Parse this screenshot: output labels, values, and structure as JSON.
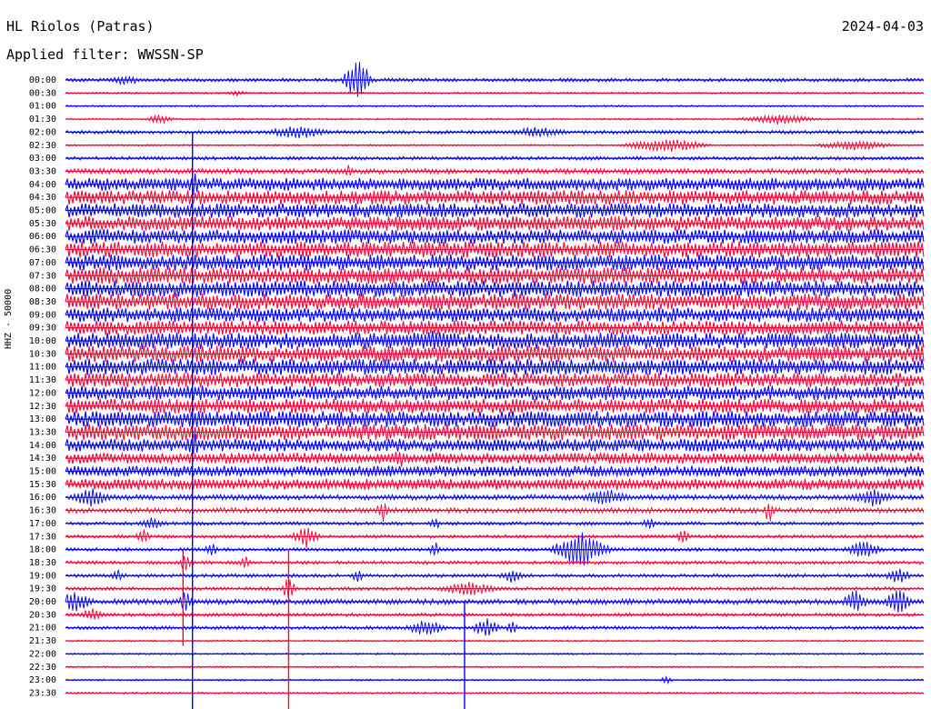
{
  "header": {
    "station": "HL Riolos (Patras)",
    "date": "2024-04-03",
    "filter_text": "Applied filter: WWSSN-SP"
  },
  "channel_label": "HHZ - 50000",
  "colors": {
    "trace_a": "#0000ff",
    "trace_b": "#ff0033",
    "text": "#000000"
  },
  "chart_data": {
    "type": "line",
    "title": "HL Riolos (Patras)",
    "subtitle": "Applied filter: WWSSN-SP",
    "ylabel": "HHZ - 50000",
    "xlabel": "",
    "grid": false,
    "row_labels": [
      "00:00",
      "00:30",
      "01:00",
      "01:30",
      "02:00",
      "02:30",
      "03:00",
      "03:30",
      "04:00",
      "04:30",
      "05:00",
      "05:30",
      "06:00",
      "06:30",
      "07:00",
      "07:30",
      "08:00",
      "08:30",
      "09:00",
      "09:30",
      "10:00",
      "10:30",
      "11:00",
      "11:30",
      "12:00",
      "12:30",
      "13:00",
      "13:30",
      "14:00",
      "14:30",
      "15:00",
      "15:30",
      "16:00",
      "16:30",
      "17:00",
      "17:30",
      "18:00",
      "18:30",
      "19:00",
      "19:30",
      "20:00",
      "20:30",
      "21:00",
      "21:30",
      "22:00",
      "22:30",
      "23:00",
      "23:30"
    ],
    "noise_level": [
      2,
      1,
      1,
      1,
      2,
      1,
      2,
      3,
      7,
      8,
      8,
      8,
      8,
      9,
      9,
      9,
      9,
      9,
      8,
      8,
      9,
      9,
      9,
      8,
      8,
      8,
      9,
      9,
      7,
      6,
      6,
      6,
      3,
      3,
      2,
      2,
      2,
      2,
      2,
      2,
      3,
      2,
      2,
      1,
      1,
      1,
      1,
      1
    ],
    "bursts": [
      {
        "row": 0,
        "x": 0.34,
        "amp": 28,
        "width": 0.02
      },
      {
        "row": 0,
        "x": 0.07,
        "amp": 6,
        "width": 0.03
      },
      {
        "row": 1,
        "x": 0.2,
        "amp": 3,
        "width": 0.02
      },
      {
        "row": 3,
        "x": 0.11,
        "amp": 6,
        "width": 0.02
      },
      {
        "row": 3,
        "x": 0.83,
        "amp": 6,
        "width": 0.06
      },
      {
        "row": 4,
        "x": 0.27,
        "amp": 8,
        "width": 0.05
      },
      {
        "row": 4,
        "x": 0.55,
        "amp": 6,
        "width": 0.05
      },
      {
        "row": 5,
        "x": 0.7,
        "amp": 9,
        "width": 0.06
      },
      {
        "row": 5,
        "x": 0.92,
        "amp": 6,
        "width": 0.06
      },
      {
        "row": 7,
        "x": 0.33,
        "amp": 8,
        "width": 0.01
      },
      {
        "row": 8,
        "x": 0.15,
        "amp": 14,
        "width": 0.01
      },
      {
        "row": 20,
        "x": 0.43,
        "amp": 12,
        "width": 0.06
      },
      {
        "row": 28,
        "x": 0.15,
        "amp": 16,
        "width": 0.01
      },
      {
        "row": 29,
        "x": 0.39,
        "amp": 14,
        "width": 0.01
      },
      {
        "row": 32,
        "x": 0.03,
        "amp": 12,
        "width": 0.03
      },
      {
        "row": 32,
        "x": 0.63,
        "amp": 10,
        "width": 0.04
      },
      {
        "row": 32,
        "x": 0.94,
        "amp": 12,
        "width": 0.03
      },
      {
        "row": 33,
        "x": 0.37,
        "amp": 14,
        "width": 0.01
      },
      {
        "row": 33,
        "x": 0.82,
        "amp": 14,
        "width": 0.01
      },
      {
        "row": 34,
        "x": 0.1,
        "amp": 8,
        "width": 0.02
      },
      {
        "row": 34,
        "x": 0.43,
        "amp": 8,
        "width": 0.01
      },
      {
        "row": 34,
        "x": 0.68,
        "amp": 8,
        "width": 0.01
      },
      {
        "row": 35,
        "x": 0.09,
        "amp": 12,
        "width": 0.01
      },
      {
        "row": 35,
        "x": 0.28,
        "amp": 14,
        "width": 0.02
      },
      {
        "row": 35,
        "x": 0.72,
        "amp": 10,
        "width": 0.01
      },
      {
        "row": 36,
        "x": 0.6,
        "amp": 22,
        "width": 0.04
      },
      {
        "row": 36,
        "x": 0.17,
        "amp": 10,
        "width": 0.01
      },
      {
        "row": 36,
        "x": 0.43,
        "amp": 10,
        "width": 0.01
      },
      {
        "row": 36,
        "x": 0.93,
        "amp": 10,
        "width": 0.03
      },
      {
        "row": 37,
        "x": 0.14,
        "amp": 10,
        "width": 0.01
      },
      {
        "row": 37,
        "x": 0.21,
        "amp": 8,
        "width": 0.01
      },
      {
        "row": 38,
        "x": 0.06,
        "amp": 8,
        "width": 0.01
      },
      {
        "row": 38,
        "x": 0.34,
        "amp": 8,
        "width": 0.01
      },
      {
        "row": 38,
        "x": 0.52,
        "amp": 8,
        "width": 0.02
      },
      {
        "row": 38,
        "x": 0.97,
        "amp": 10,
        "width": 0.02
      },
      {
        "row": 39,
        "x": 0.26,
        "amp": 14,
        "width": 0.01
      },
      {
        "row": 39,
        "x": 0.47,
        "amp": 8,
        "width": 0.05
      },
      {
        "row": 40,
        "x": 0.01,
        "amp": 14,
        "width": 0.03
      },
      {
        "row": 40,
        "x": 0.14,
        "amp": 14,
        "width": 0.01
      },
      {
        "row": 40,
        "x": 0.92,
        "amp": 14,
        "width": 0.02
      },
      {
        "row": 40,
        "x": 0.97,
        "amp": 16,
        "width": 0.02
      },
      {
        "row": 41,
        "x": 0.03,
        "amp": 8,
        "width": 0.02
      },
      {
        "row": 42,
        "x": 0.42,
        "amp": 10,
        "width": 0.03
      },
      {
        "row": 42,
        "x": 0.49,
        "amp": 12,
        "width": 0.02
      },
      {
        "row": 42,
        "x": 0.52,
        "amp": 8,
        "width": 0.01
      },
      {
        "row": 46,
        "x": 0.7,
        "amp": 5,
        "width": 0.01
      }
    ],
    "spikes": [
      {
        "x": 0.148,
        "from_row": 4,
        "to_row": 47
      },
      {
        "x": 0.26,
        "from_row": 36,
        "to_row": 47
      },
      {
        "x": 0.465,
        "from_row": 40,
        "to_row": 47
      },
      {
        "x": 0.137,
        "from_row": 36,
        "to_row": 42
      }
    ]
  }
}
